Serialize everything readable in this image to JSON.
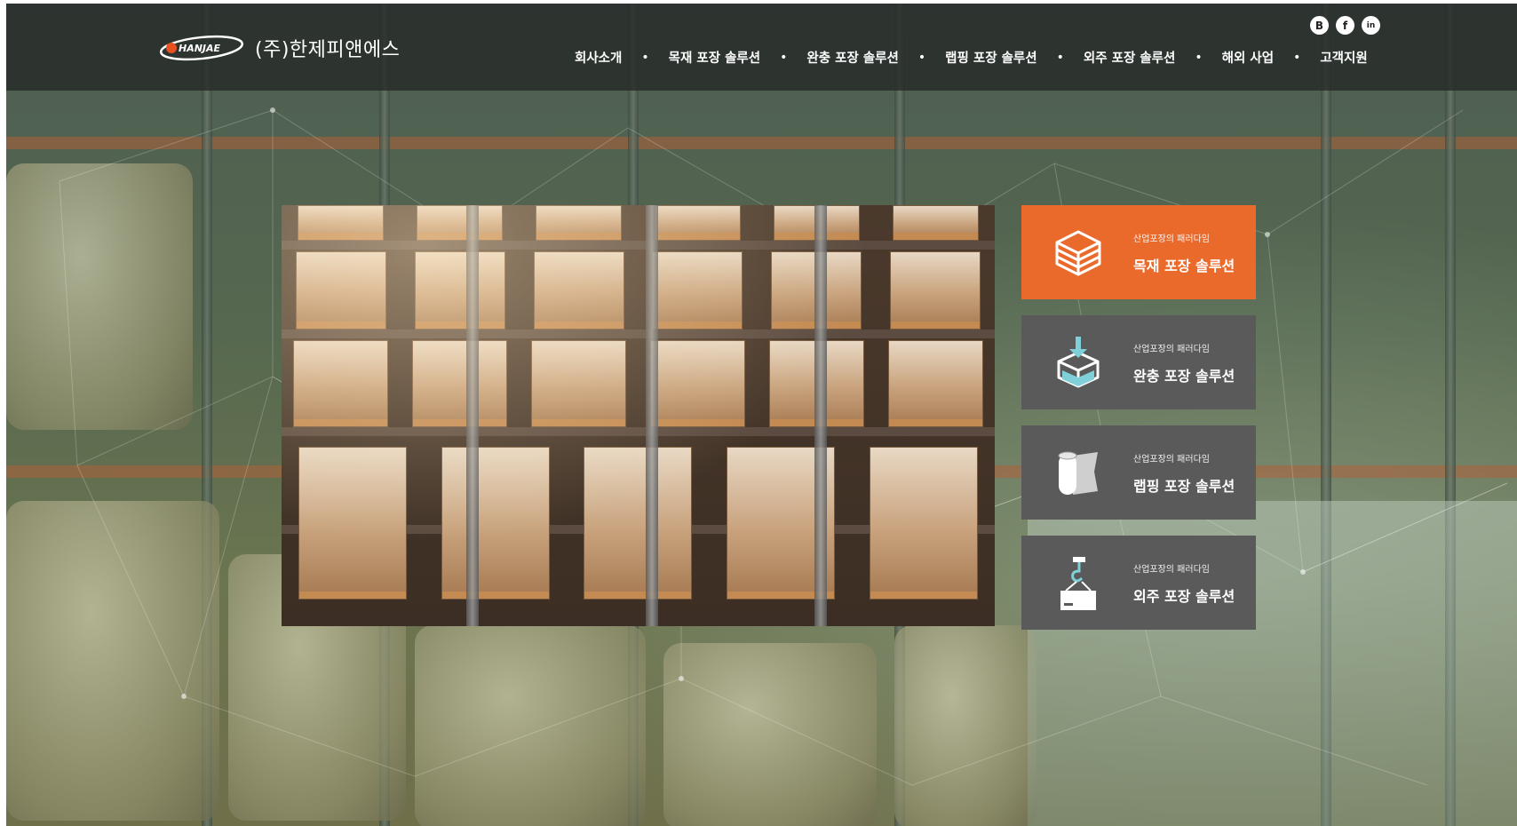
{
  "header": {
    "logo_mark": "HANJAE",
    "company_name": "(주)한제피앤에스",
    "nav": [
      {
        "label": "회사소개"
      },
      {
        "label": "목재 포장 솔루션"
      },
      {
        "label": "완충 포장 솔루션"
      },
      {
        "label": "랩핑 포장 솔루션"
      },
      {
        "label": "외주 포장 솔루션"
      },
      {
        "label": "해외 사업"
      },
      {
        "label": "고객지원"
      }
    ],
    "social": [
      {
        "icon": "blog-icon",
        "glyph": "B"
      },
      {
        "icon": "facebook-icon",
        "glyph": "f"
      },
      {
        "icon": "linkedin-icon",
        "glyph": "in"
      }
    ]
  },
  "cards": [
    {
      "subtitle": "산업포장의 패러다임",
      "title": "목재 포장 솔루션",
      "icon": "wood-box-icon",
      "active": true
    },
    {
      "subtitle": "산업포장의 패러다임",
      "title": "완충 포장 솔루션",
      "icon": "cushion-box-icon",
      "active": false
    },
    {
      "subtitle": "산업포장의 패러다임",
      "title": "랩핑 포장 솔루션",
      "icon": "wrap-roll-icon",
      "active": false
    },
    {
      "subtitle": "산업포장의 패러다임",
      "title": "외주 포장 솔루션",
      "icon": "hook-box-icon",
      "active": false
    }
  ],
  "colors": {
    "accent": "#ea6a2c",
    "card_inactive": "#5a5a5a",
    "header_bg": "#242826"
  }
}
